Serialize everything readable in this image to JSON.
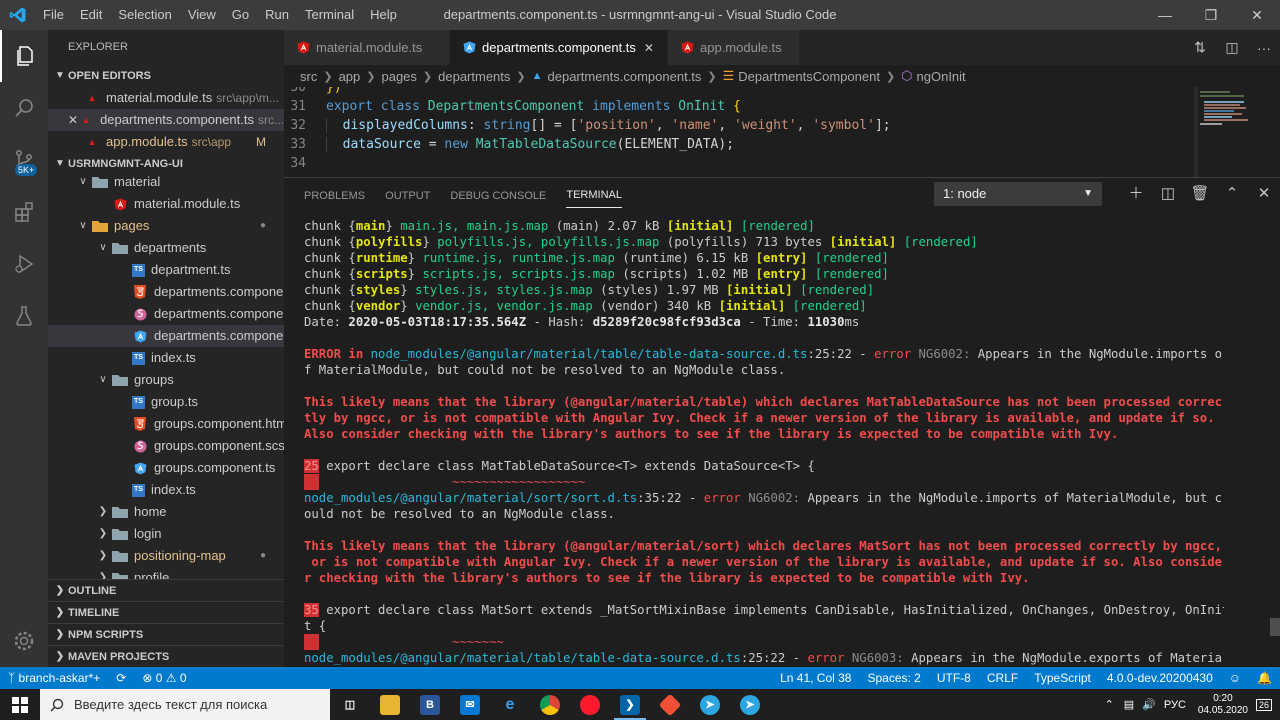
{
  "window": {
    "title": "departments.component.ts - usrmngmnt-ang-ui - Visual Studio Code",
    "menu": [
      "File",
      "Edit",
      "Selection",
      "View",
      "Go",
      "Run",
      "Terminal",
      "Help"
    ]
  },
  "activity": {
    "badge": "5K+"
  },
  "sidebar": {
    "title": "EXPLORER",
    "open_editors_header": "OPEN EDITORS",
    "open_editors": [
      {
        "name": "material.module.ts",
        "path": "src\\app\\m...",
        "closeable": false
      },
      {
        "name": "departments.component.ts",
        "path": "src...",
        "closeable": true
      },
      {
        "name": "app.module.ts",
        "path": "src\\app",
        "badge": "M"
      }
    ],
    "project_header": "USRMNGMNT-ANG-UI",
    "tree": [
      {
        "name": "material",
        "type": "folder",
        "open": true,
        "depth": 1
      },
      {
        "name": "material.module.ts",
        "type": "angular",
        "depth": 2
      },
      {
        "name": "pages",
        "type": "folder-orange",
        "open": true,
        "depth": 1,
        "dot": "●"
      },
      {
        "name": "departments",
        "type": "folder",
        "open": true,
        "depth": 2
      },
      {
        "name": "department.ts",
        "type": "ts",
        "depth": 3
      },
      {
        "name": "departments.componen...",
        "type": "html",
        "depth": 3
      },
      {
        "name": "departments.componen...",
        "type": "scss",
        "depth": 3
      },
      {
        "name": "departments.componen...",
        "type": "angular",
        "depth": 3,
        "selected": true
      },
      {
        "name": "index.ts",
        "type": "ts",
        "depth": 3
      },
      {
        "name": "groups",
        "type": "folder",
        "open": true,
        "depth": 2
      },
      {
        "name": "group.ts",
        "type": "ts",
        "depth": 3
      },
      {
        "name": "groups.component.html",
        "type": "html",
        "depth": 3
      },
      {
        "name": "groups.component.scss",
        "type": "scss",
        "depth": 3
      },
      {
        "name": "groups.component.ts",
        "type": "angular",
        "depth": 3
      },
      {
        "name": "index.ts",
        "type": "ts",
        "depth": 3
      },
      {
        "name": "home",
        "type": "folder",
        "open": false,
        "depth": 2
      },
      {
        "name": "login",
        "type": "folder",
        "open": false,
        "depth": 2
      },
      {
        "name": "positioning-map",
        "type": "folder",
        "open": false,
        "depth": 2,
        "dot": "●"
      },
      {
        "name": "profile",
        "type": "folder",
        "open": false,
        "depth": 2
      }
    ],
    "bottom_sections": [
      "OUTLINE",
      "TIMELINE",
      "NPM SCRIPTS",
      "MAVEN PROJECTS"
    ]
  },
  "tabs": [
    {
      "label": "material.module.ts",
      "active": false
    },
    {
      "label": "departments.component.ts",
      "active": true,
      "close": "✕"
    },
    {
      "label": "app.module.ts",
      "active": false
    }
  ],
  "breadcrumbs": [
    "src",
    "app",
    "pages",
    "departments",
    "departments.component.ts",
    "DepartmentsComponent",
    "ngOnInit"
  ],
  "code": {
    "lines": [
      {
        "num": "30",
        "text": "})"
      },
      {
        "num": "31",
        "text": "export class DepartmentsComponent implements OnInit {"
      },
      {
        "num": "32",
        "text": "  displayedColumns: string[] = ['position', 'name', 'weight', 'symbol'];"
      },
      {
        "num": "33",
        "text": "  dataSource = new MatTableDataSource(ELEMENT_DATA);"
      },
      {
        "num": "34",
        "text": ""
      }
    ]
  },
  "panel": {
    "tabs": [
      "PROBLEMS",
      "OUTPUT",
      "DEBUG CONSOLE",
      "TERMINAL"
    ],
    "active_tab": "TERMINAL",
    "terminal_select": "1: node"
  },
  "terminal": {
    "chunks": [
      {
        "name": "main",
        "files": "main.js, main.js.map",
        "rest": " (main) 2.07 kB ",
        "tags": [
          "[initial]"
        ],
        "rendered": "[rendered]"
      },
      {
        "name": "polyfills",
        "files": "polyfills.js, polyfills.js.map",
        "rest": " (polyfills) 713 bytes ",
        "tags": [
          "[initial]"
        ],
        "rendered": "[rendered]"
      },
      {
        "name": "runtime",
        "files": "runtime.js, runtime.js.map",
        "rest": " (runtime) 6.15 kB ",
        "tags": [
          "[entry]"
        ],
        "rendered": "[rendered]"
      },
      {
        "name": "scripts",
        "files": "scripts.js, scripts.js.map",
        "rest": " (scripts) 1.02 MB ",
        "tags": [
          "[entry]"
        ],
        "rendered": "[rendered]"
      },
      {
        "name": "styles",
        "files": "styles.js, styles.js.map",
        "rest": " (styles) 1.97 MB ",
        "tags": [
          "[initial]"
        ],
        "rendered": "[rendered]"
      },
      {
        "name": "vendor",
        "files": "vendor.js, vendor.js.map",
        "rest": " (vendor) 340 kB ",
        "tags": [
          "[initial]"
        ],
        "rendered": "[rendered]"
      }
    ],
    "date_label": "Date: ",
    "date": "2020-05-03T18:17:35.564Z",
    "hash_label": " - Hash: ",
    "hash": "d5289f20c98fcf93d3ca",
    "time_label": " - Time: ",
    "time": "11030",
    "time_unit": "ms",
    "error1": {
      "prefix": "ERROR in ",
      "file": "node_modules/@angular/material/table/table-data-source.d.ts",
      "loc": ":25:22",
      "dash": " - ",
      "level": "error",
      "code": " NG6002: ",
      "msg1": "Appears in the NgModule.imports o",
      "msg2": "f MaterialModule, but could not be resolved to an NgModule class."
    },
    "likely1": [
      "This likely means that the library (@angular/material/table) which declares MatTableDataSource has not been processed correc",
      "tly by ngcc, or is not compatible with Angular Ivy. Check if a newer version of the library is available, and update if so.",
      "Also consider checking with the library's authors to see if the library is expected to be compatible with Ivy."
    ],
    "snippet1_num": "25",
    "snippet1": " export declare class MatTableDataSource<T> extends DataSource<T> {",
    "tilde1": "                  ~~~~~~~~~~~~~~~~~~",
    "error2": {
      "file": "node_modules/@angular/material/sort/sort.d.ts",
      "loc": ":35:22",
      "dash": " - ",
      "level": "error",
      "code": " NG6002: ",
      "msg1": "Appears in the NgModule.imports of MaterialModule, but c",
      "msg2": "ould not be resolved to an NgModule class."
    },
    "likely2": [
      "This likely means that the library (@angular/material/sort) which declares MatSort has not been processed correctly by ngcc,",
      " or is not compatible with Angular Ivy. Check if a newer version of the library is available, and update if so. Also conside",
      "r checking with the library's authors to see if the library is expected to be compatible with Ivy."
    ],
    "snippet2_num": "35",
    "snippet2": " export declare class MatSort extends _MatSortMixinBase implements CanDisable, HasInitialized, OnChanges, OnDestroy, OnInit",
    "snippet2b": "t {",
    "tilde2": "                  ~~~~~~~",
    "error3": {
      "file": "node_modules/@angular/material/table/table-data-source.d.ts",
      "loc": ":25:22",
      "dash": " - ",
      "level": "error",
      "code": " NG6003: ",
      "msg1": "Appears in the NgModule.exports of Materia"
    }
  },
  "statusbar": {
    "branch": "branch-askar*+",
    "errors": "0",
    "warnings": "0",
    "position": "Ln 41, Col 38",
    "spaces": "Spaces: 2",
    "encoding": "UTF-8",
    "eol": "CRLF",
    "language": "TypeScript",
    "version": "4.0.0-dev.20200430"
  },
  "taskbar": {
    "search_placeholder": "Введите здесь текст для поиска",
    "lang": "РУС",
    "time": "0:20",
    "date": "04.05.2020",
    "notif": "26"
  },
  "colors": {
    "accent": "#007acc",
    "error": "#f14c4c",
    "link": "#29b8db"
  }
}
